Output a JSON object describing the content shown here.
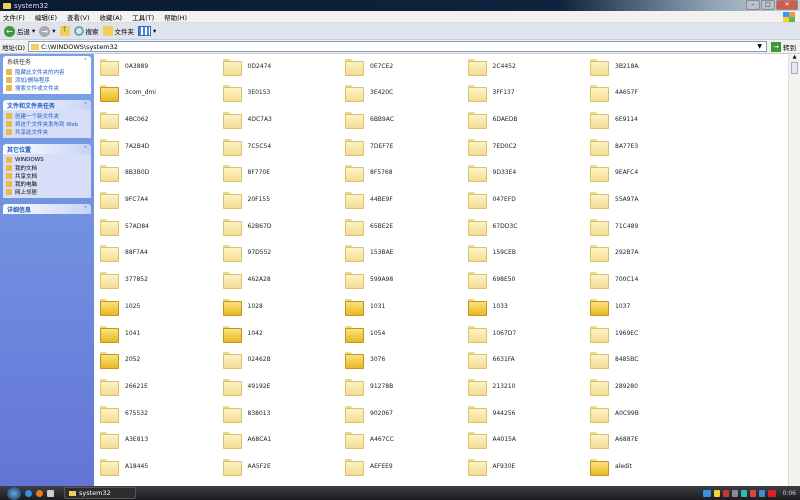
{
  "window": {
    "title": "system32"
  },
  "menu": [
    "文件(F)",
    "编辑(E)",
    "查看(V)",
    "收藏(A)",
    "工具(T)",
    "帮助(H)"
  ],
  "toolbar": {
    "back": "后退",
    "search": "搜索",
    "folders": "文件夹"
  },
  "address": {
    "label": "地址(D)",
    "value": "C:\\WINDOWS\\system32",
    "go": "转到"
  },
  "sidebar": {
    "panels": [
      {
        "title": "系统任务",
        "plain": true,
        "expanded": true,
        "items": [
          "隐藏此文件夹的内容",
          "添加/删除程序",
          "搜索文件或文件夹"
        ]
      },
      {
        "title": "文件和文件夹任务",
        "expanded": true,
        "items": [
          "创建一个新文件夹",
          "将这个文件夹发布到 Web",
          "共享此文件夹"
        ]
      },
      {
        "title": "其它位置",
        "expanded": true,
        "items": [
          "WINDOWS",
          "我的文档",
          "共享文档",
          "我的电脑",
          "网上邻居"
        ]
      },
      {
        "title": "详细信息",
        "expanded": false,
        "items": []
      }
    ]
  },
  "files": [
    {
      "n": "0A3889"
    },
    {
      "n": "0D2474"
    },
    {
      "n": "0E7CE2"
    },
    {
      "n": "2C4452"
    },
    {
      "n": "3B218A"
    },
    {
      "n": "3com_dmi",
      "full": true
    },
    {
      "n": "3E0153"
    },
    {
      "n": "3E420C"
    },
    {
      "n": "3FF137"
    },
    {
      "n": "4A657F"
    },
    {
      "n": "4BC062"
    },
    {
      "n": "4DC7A3"
    },
    {
      "n": "6BB9AC"
    },
    {
      "n": "6DAEDB"
    },
    {
      "n": "6E9114"
    },
    {
      "n": "7A2B4D"
    },
    {
      "n": "7C5C54"
    },
    {
      "n": "7DEF7E"
    },
    {
      "n": "7ED0C2"
    },
    {
      "n": "8A77E3"
    },
    {
      "n": "8B3B0D"
    },
    {
      "n": "8F770E"
    },
    {
      "n": "8F5768"
    },
    {
      "n": "9D33E4"
    },
    {
      "n": "9EAFC4"
    },
    {
      "n": "9FC7A4"
    },
    {
      "n": "20F155"
    },
    {
      "n": "44BE9F"
    },
    {
      "n": "047EFD"
    },
    {
      "n": "55A97A"
    },
    {
      "n": "57AD84"
    },
    {
      "n": "62B67D"
    },
    {
      "n": "65BE2E"
    },
    {
      "n": "67DD3C"
    },
    {
      "n": "71C489"
    },
    {
      "n": "88F7A4"
    },
    {
      "n": "97D552"
    },
    {
      "n": "153BAE"
    },
    {
      "n": "159CEB"
    },
    {
      "n": "292B7A"
    },
    {
      "n": "377852"
    },
    {
      "n": "462A28"
    },
    {
      "n": "599A98"
    },
    {
      "n": "698E50"
    },
    {
      "n": "700C14"
    },
    {
      "n": "1025",
      "full": true
    },
    {
      "n": "1028",
      "full": true
    },
    {
      "n": "1031",
      "full": true
    },
    {
      "n": "1033",
      "full": true
    },
    {
      "n": "1037",
      "full": true
    },
    {
      "n": "1041",
      "full": true
    },
    {
      "n": "1042",
      "full": true
    },
    {
      "n": "1054",
      "full": true
    },
    {
      "n": "1067D7"
    },
    {
      "n": "1969EC"
    },
    {
      "n": "2052",
      "full": true
    },
    {
      "n": "02462B"
    },
    {
      "n": "3076",
      "full": true
    },
    {
      "n": "6631FA"
    },
    {
      "n": "8485BC"
    },
    {
      "n": "26621E"
    },
    {
      "n": "49192E"
    },
    {
      "n": "91278B"
    },
    {
      "n": "213210"
    },
    {
      "n": "289280"
    },
    {
      "n": "675532"
    },
    {
      "n": "838013"
    },
    {
      "n": "902067"
    },
    {
      "n": "944256"
    },
    {
      "n": "A0C99B"
    },
    {
      "n": "A3E813"
    },
    {
      "n": "A68CA1"
    },
    {
      "n": "A467CC"
    },
    {
      "n": "A4015A"
    },
    {
      "n": "A6887E"
    },
    {
      "n": "A18445"
    },
    {
      "n": "AA5F2E"
    },
    {
      "n": "AEFEE9"
    },
    {
      "n": "AF930E"
    },
    {
      "n": "aledit",
      "full": true
    }
  ],
  "taskbar": {
    "task": "system32",
    "clock": "0:06"
  }
}
